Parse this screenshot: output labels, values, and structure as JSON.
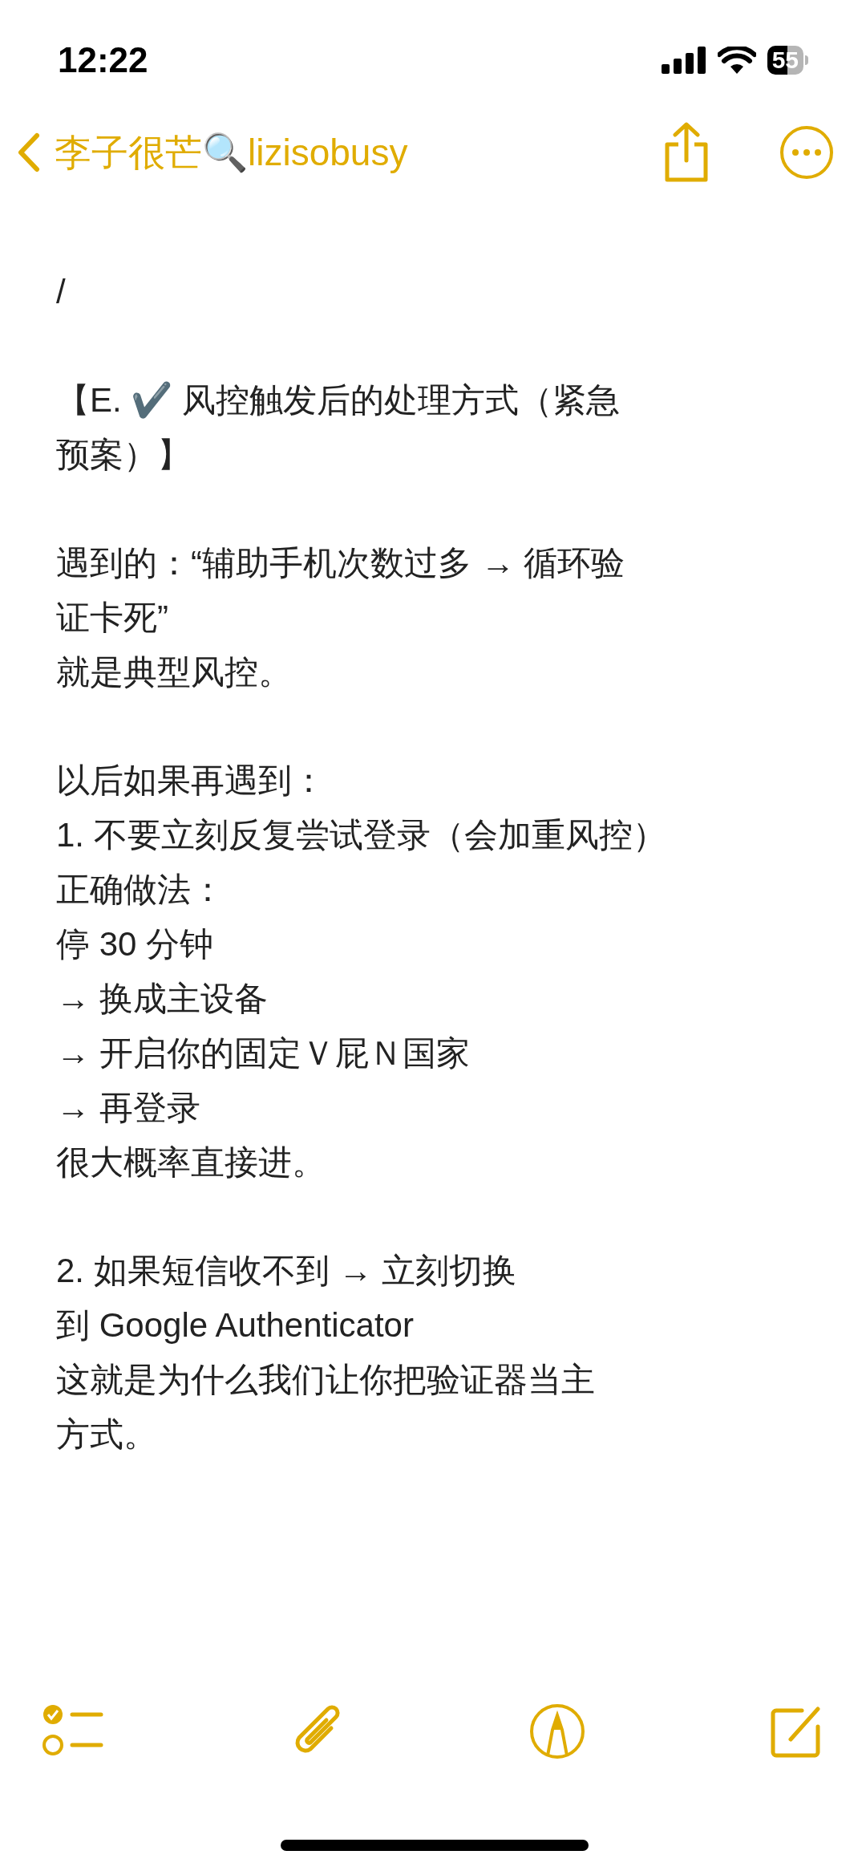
{
  "status_bar": {
    "time": "12:22",
    "battery": "55"
  },
  "nav": {
    "back_title": "李子很芒🔍lizisobusy"
  },
  "paragraphs": [
    [
      "/"
    ],
    [
      "【E. ✔️ 风控触发后的处理方式（紧急",
      "预案）】"
    ],
    [
      "遇到的：“辅助手机次数过多 → 循环验",
      "证卡死”",
      "就是典型风控。"
    ],
    [
      "以后如果再遇到：",
      "1. 不要立刻反复尝试登录（会加重风控）",
      "正确做法：",
      "停 30 分钟",
      "→ 换成主设备",
      "→ 开启你的固定Ｖ屁Ｎ国家",
      "→ 再登录",
      "很大概率直接进。"
    ],
    [
      "2. 如果短信收不到 → 立刻切换",
      "到 Google Authenticator",
      "这就是为什么我们让你把验证器当主",
      "方式。"
    ]
  ]
}
